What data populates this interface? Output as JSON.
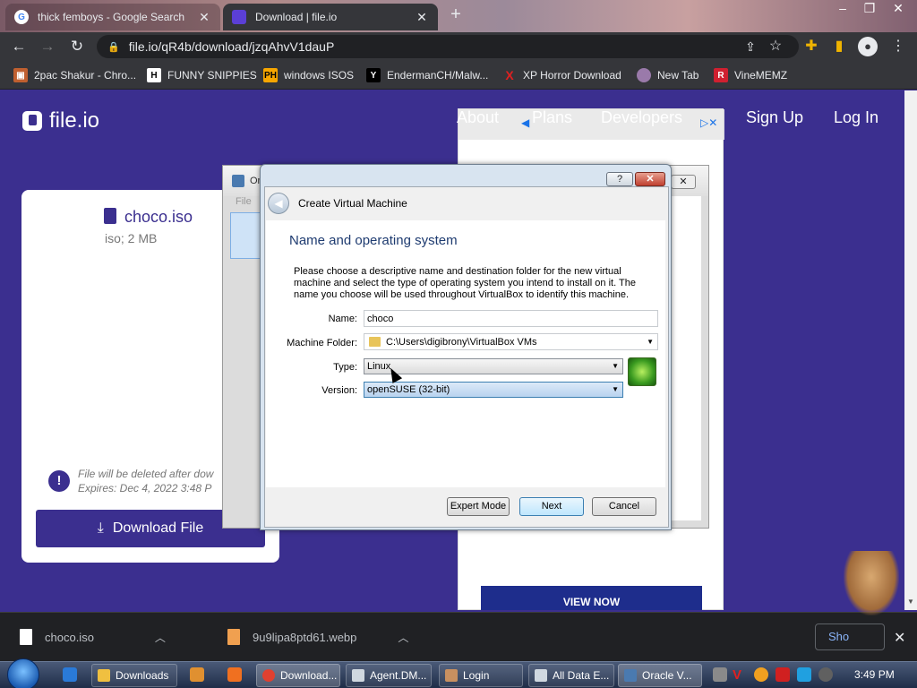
{
  "browser": {
    "tabs": [
      {
        "title": "thick femboys - Google Search",
        "active": false
      },
      {
        "title": "Download | file.io",
        "active": true
      }
    ],
    "url": "file.io/qR4b/download/jzqAhvV1dauP",
    "bookmarks": [
      {
        "label": "2pac Shakur - Chro..."
      },
      {
        "label": "FUNNY SNIPPIES"
      },
      {
        "label": "windows ISOS"
      },
      {
        "label": "EndermanCH/Malw..."
      },
      {
        "label": "XP Horror Download"
      },
      {
        "label": "New Tab"
      },
      {
        "label": "VineMEMZ"
      }
    ]
  },
  "site": {
    "logo": "file.io",
    "nav": [
      "About",
      "Plans",
      "Developers",
      "Sign Up",
      "Log In"
    ],
    "file": {
      "name": "choco.iso",
      "meta": "iso; 2 MB",
      "delete_note": "File will be deleted after dow",
      "expires": "Expires: Dec 4, 2022 3:48 P",
      "download_label": "Download File"
    },
    "ad": {
      "cta": "VIEW NOW"
    }
  },
  "vbox_manager": {
    "title": "Or",
    "menu": "File"
  },
  "dialog": {
    "title": "Create Virtual Machine",
    "help": "?",
    "heading": "Name and operating system",
    "description": "Please choose a descriptive name and destination folder for the new virtual machine and select the type of operating system you intend to install on it. The name you choose will be used throughout VirtualBox to identify this machine.",
    "fields": {
      "name_label": "Name:",
      "name_value": "choco",
      "folder_label": "Machine Folder:",
      "folder_value": "C:\\Users\\digibrony\\VirtualBox VMs",
      "type_label": "Type:",
      "type_value": "Linux",
      "version_label": "Version:",
      "version_value": "openSUSE (32-bit)"
    },
    "buttons": {
      "expert": "Expert Mode",
      "next": "Next",
      "cancel": "Cancel"
    }
  },
  "downloads": [
    {
      "name": "choco.iso"
    },
    {
      "name": "9u9lipa8ptd61.webp"
    }
  ],
  "downloads_show_all": "Sho",
  "taskbar": {
    "buttons": [
      "Downloads",
      "Download...",
      "Agent.DM...",
      "Login",
      "All Data E...",
      "Oracle V..."
    ],
    "clock": "3:49 PM"
  }
}
